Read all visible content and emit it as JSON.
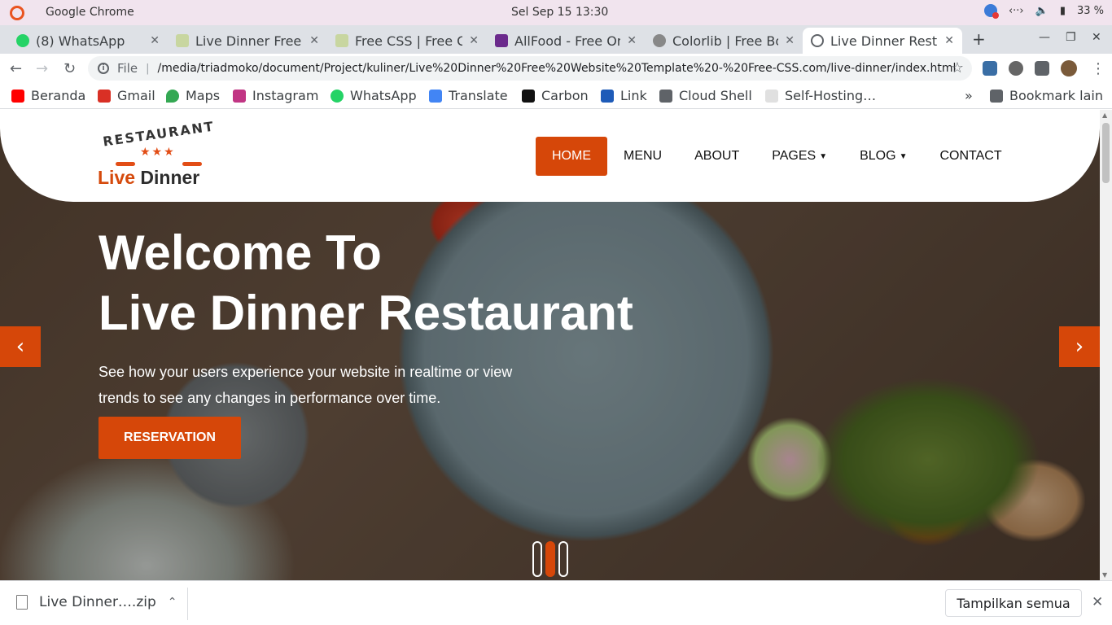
{
  "os": {
    "app_name": "Google Chrome",
    "clock": "Sel Sep 15  13:30",
    "battery": "33 %"
  },
  "tabs": [
    {
      "title": "(8) WhatsApp",
      "color": "#25d366"
    },
    {
      "title": "Live Dinner Free",
      "color": "#c8d6a0"
    },
    {
      "title": "Free CSS | Free C",
      "color": "#c8d6a0"
    },
    {
      "title": "AllFood - Free On",
      "color": "#6b2a8c"
    },
    {
      "title": "Colorlib | Free Bo",
      "color": "#888888"
    },
    {
      "title": "Live Dinner Resta",
      "color": "#5f6368"
    }
  ],
  "address": {
    "scheme": "File",
    "url": "/media/triadmoko/document/Project/kuliner/Live%20Dinner%20Free%20Website%20Template%20-%20Free-CSS.com/live-dinner/index.html"
  },
  "bookmarks": [
    {
      "label": "Beranda",
      "color": "#ff0000"
    },
    {
      "label": "Gmail",
      "color": "#d93025"
    },
    {
      "label": "Maps",
      "color": "#34a853"
    },
    {
      "label": "Instagram",
      "color": "#c13584"
    },
    {
      "label": "WhatsApp",
      "color": "#25d366"
    },
    {
      "label": "Translate",
      "color": "#4285f4"
    },
    {
      "label": "Carbon",
      "color": "#111111"
    },
    {
      "label": "Link",
      "color": "#1e5bb8"
    },
    {
      "label": "Cloud Shell",
      "color": "#5f6368"
    },
    {
      "label": "Self-Hosting…",
      "color": "#9aa0a6"
    }
  ],
  "bookmarks_more": "Bookmark lain",
  "site": {
    "logo": {
      "top": "RESTAURANT",
      "stars": "★★★",
      "main_accent": "Live",
      "main_rest": " Dinner"
    },
    "nav": [
      {
        "label": "HOME",
        "active": true,
        "dropdown": false
      },
      {
        "label": "MENU",
        "active": false,
        "dropdown": false
      },
      {
        "label": "ABOUT",
        "active": false,
        "dropdown": false
      },
      {
        "label": "PAGES",
        "active": false,
        "dropdown": true
      },
      {
        "label": "BLOG",
        "active": false,
        "dropdown": true
      },
      {
        "label": "CONTACT",
        "active": false,
        "dropdown": false
      }
    ],
    "hero": {
      "title_line1": "Welcome To",
      "title_line2": "Live Dinner Restaurant",
      "subtitle": "See how your users experience your website in realtime or view trends to see any changes in performance over time.",
      "cta": "RESERVATION"
    },
    "accent": "#d64709"
  },
  "downloads": {
    "file": "Live Dinner….zip",
    "show_all": "Tampilkan semua"
  }
}
